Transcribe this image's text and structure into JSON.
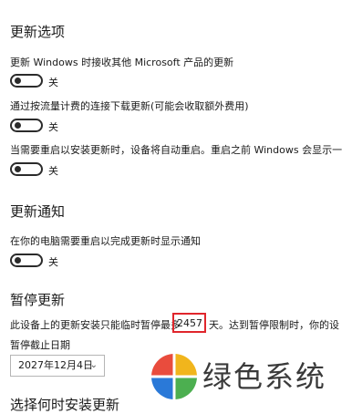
{
  "sections": {
    "update_options": {
      "title": "更新选项",
      "items": [
        {
          "label": "更新 Windows 时接收其他 Microsoft 产品的更新",
          "state": "关"
        },
        {
          "label": "通过按流量计费的连接下载更新(可能会收取额外费用)",
          "state": "关"
        },
        {
          "label": "当需要重启以安装更新时，设备将自动重启。重启之前 Windows 会显示一",
          "state": "关"
        }
      ]
    },
    "update_notifications": {
      "title": "更新通知",
      "items": [
        {
          "label": "在你的电脑需要重启以完成更新时显示通知",
          "state": "关"
        }
      ]
    },
    "pause_updates": {
      "title": "暂停更新",
      "text_before": "此设备上的更新安装只能临时暂停最多",
      "days": "2457",
      "text_after": "天。达到暂停限制时，你的设",
      "until_label": "暂停截止日期",
      "date_value": "2027年12月4日"
    },
    "next_section": {
      "title": "选择何时安装更新"
    }
  },
  "watermark": {
    "text": "绿色系统",
    "colors": [
      "#e94c3d",
      "#f1b51c",
      "#4caf50",
      "#2a79d8"
    ]
  }
}
